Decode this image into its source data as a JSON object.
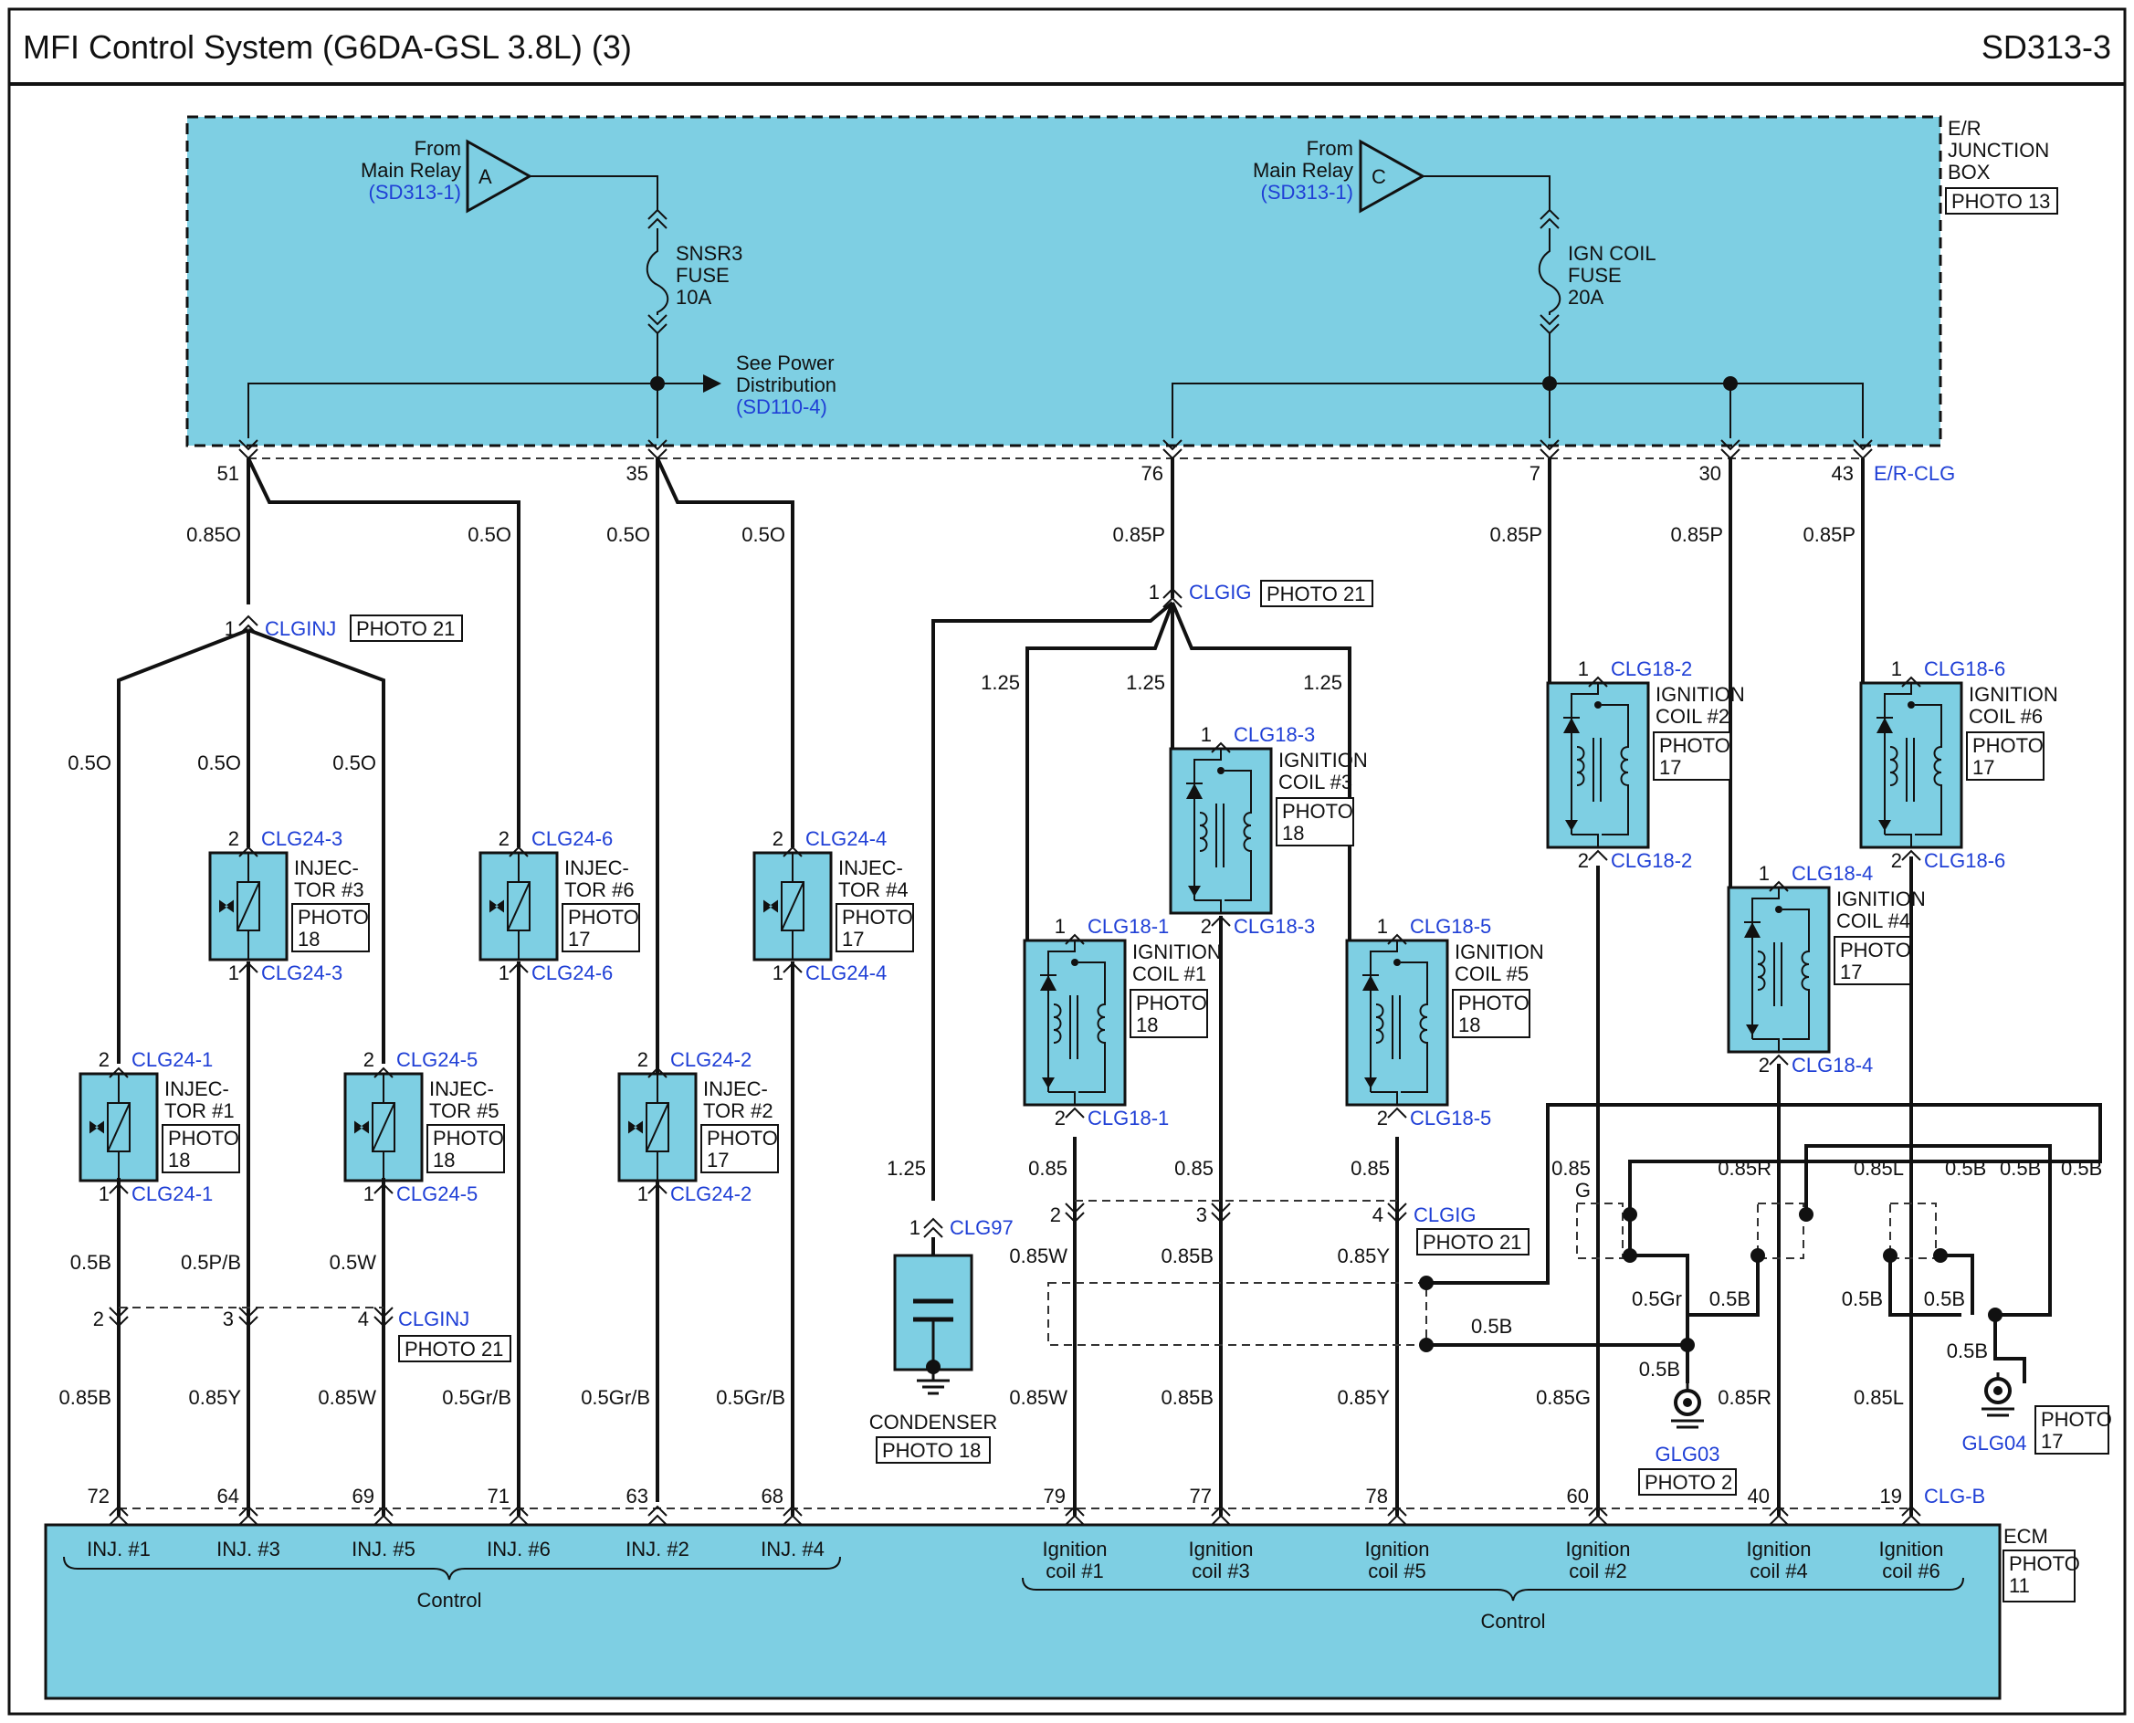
{
  "header": {
    "title": "MFI Control System (G6DA-GSL 3.8L) (3)",
    "code": "SD313-3"
  },
  "junction_box": {
    "name_lines": [
      "E/R",
      "JUNCTION",
      "BOX"
    ],
    "photo": "PHOTO 13"
  },
  "relays": [
    {
      "label_lines": [
        "From",
        "Main Relay"
      ],
      "ref": "(SD313-1)",
      "letter": "A"
    },
    {
      "label_lines": [
        "From",
        "Main Relay"
      ],
      "ref": "(SD313-1)",
      "letter": "C"
    }
  ],
  "fuses": [
    {
      "lines": [
        "SNSR3",
        "FUSE",
        "10A"
      ]
    },
    {
      "lines": [
        "IGN COIL",
        "FUSE",
        "20A"
      ]
    }
  ],
  "power_dist": {
    "lines": [
      "See Power",
      "Distribution"
    ],
    "ref": "(SD110-4)"
  },
  "er_pins": [
    "51",
    "35",
    "76",
    "7",
    "30",
    "43"
  ],
  "er_connector": "E/R-CLG",
  "wires_top": [
    "0.85O",
    "0.5O",
    "0.5O",
    "0.5O",
    "0.85P",
    "0.85P",
    "0.85P",
    "0.85P"
  ],
  "splices": {
    "clginj": {
      "pin": "1",
      "name": "CLGINJ",
      "photo": "PHOTO 21"
    },
    "clgig": {
      "pin": "1",
      "name": "CLGIG",
      "photo": "PHOTO 21"
    }
  },
  "injectors": [
    {
      "name_lines": [
        "INJEC-",
        "TOR #1"
      ],
      "photo": "PHOTO",
      "photo_no": "18",
      "top_pin": "2",
      "top_conn": "CLG24-1",
      "bot_pin": "1",
      "bot_conn": "CLG24-1"
    },
    {
      "name_lines": [
        "INJEC-",
        "TOR #3"
      ],
      "photo": "PHOTO",
      "photo_no": "18",
      "top_pin": "2",
      "top_conn": "CLG24-3",
      "bot_pin": "1",
      "bot_conn": "CLG24-3"
    },
    {
      "name_lines": [
        "INJEC-",
        "TOR #5"
      ],
      "photo": "PHOTO",
      "photo_no": "18",
      "top_pin": "2",
      "top_conn": "CLG24-5",
      "bot_pin": "1",
      "bot_conn": "CLG24-5"
    },
    {
      "name_lines": [
        "INJEC-",
        "TOR #6"
      ],
      "photo": "PHOTO",
      "photo_no": "17",
      "top_pin": "2",
      "top_conn": "CLG24-6",
      "bot_pin": "1",
      "bot_conn": "CLG24-6"
    },
    {
      "name_lines": [
        "INJEC-",
        "TOR #2"
      ],
      "photo": "PHOTO",
      "photo_no": "17",
      "top_pin": "2",
      "top_conn": "CLG24-2",
      "bot_pin": "1",
      "bot_conn": "CLG24-2"
    },
    {
      "name_lines": [
        "INJEC-",
        "TOR #4"
      ],
      "photo": "PHOTO",
      "photo_no": "17",
      "top_pin": "2",
      "top_conn": "CLG24-4",
      "bot_pin": "1",
      "bot_conn": "CLG24-4"
    }
  ],
  "coils": [
    {
      "name_lines": [
        "IGNITION",
        "COIL #1"
      ],
      "photo": "PHOTO",
      "photo_no": "18",
      "top_pin": "1",
      "top_conn": "CLG18-1",
      "bot_pin": "2",
      "bot_conn": "CLG18-1"
    },
    {
      "name_lines": [
        "IGNITION",
        "COIL #3"
      ],
      "photo": "PHOTO",
      "photo_no": "18",
      "top_pin": "1",
      "top_conn": "CLG18-3",
      "bot_pin": "2",
      "bot_conn": "CLG18-3"
    },
    {
      "name_lines": [
        "IGNITION",
        "COIL #5"
      ],
      "photo": "PHOTO",
      "photo_no": "18",
      "top_pin": "1",
      "top_conn": "CLG18-5",
      "bot_pin": "2",
      "bot_conn": "CLG18-5"
    },
    {
      "name_lines": [
        "IGNITION",
        "COIL #2"
      ],
      "photo": "PHOTO",
      "photo_no": "17",
      "top_pin": "1",
      "top_conn": "CLG18-2",
      "bot_pin": "2",
      "bot_conn": "CLG18-2"
    },
    {
      "name_lines": [
        "IGNITION",
        "COIL #4"
      ],
      "photo": "PHOTO",
      "photo_no": "17",
      "top_pin": "1",
      "top_conn": "CLG18-4",
      "bot_pin": "2",
      "bot_conn": "CLG18-4"
    },
    {
      "name_lines": [
        "IGNITION",
        "COIL #6"
      ],
      "photo": "PHOTO",
      "photo_no": "17",
      "top_pin": "1",
      "top_conn": "CLG18-6",
      "bot_pin": "2",
      "bot_conn": "CLG18-6"
    }
  ],
  "condenser": {
    "name": "CONDENSER",
    "photo": "PHOTO 18",
    "pin": "1",
    "conn": "CLG97"
  },
  "mid_connectors": {
    "clginj_bottom": {
      "name": "CLGINJ",
      "photo": "PHOTO 21",
      "pins": [
        "2",
        "3",
        "4"
      ]
    },
    "clgig_bottom": {
      "name": "CLGIG",
      "photo": "PHOTO 21",
      "pins": [
        "2",
        "3",
        "4"
      ]
    }
  },
  "wire_labels": {
    "inj_upper": [
      "0.5O",
      "0.5O",
      "0.5O"
    ],
    "inj_lower": [
      "0.5B",
      "0.5P/B",
      "0.5W"
    ],
    "inj_ecm": [
      "0.85B",
      "0.85Y",
      "0.85W",
      "0.5Gr/B",
      "0.5Gr/B",
      "0.5Gr/B"
    ],
    "coil_upper": [
      "1.25",
      "1.25",
      "1.25",
      "1.25"
    ],
    "coil_mid": [
      "0.85",
      "0.85",
      "0.85"
    ],
    "coil_mid2": [
      "0.85W",
      "0.85B",
      "0.85Y"
    ],
    "coil_ecm": [
      "0.85W",
      "0.85B",
      "0.85Y",
      "0.85G",
      "0.85R",
      "0.85L"
    ],
    "shield": [
      "0.85",
      "G",
      "0.85R",
      "0.85L",
      "0.5B",
      "0.5B",
      "0.5B"
    ],
    "ground": [
      "0.5Gr",
      "0.5B",
      "0.5B",
      "0.5B",
      "0.5B",
      "0.5B",
      "0.5B"
    ]
  },
  "grounds": [
    {
      "name": "GLG03",
      "photo": "PHOTO 2"
    },
    {
      "name": "GLG04",
      "photo": "PHOTO",
      "photo_no": "17"
    }
  ],
  "ecm": {
    "name": "ECM",
    "photo": "PHOTO",
    "photo_no": "11",
    "connector": "CLG-B",
    "pins": [
      "72",
      "64",
      "69",
      "71",
      "63",
      "68",
      "79",
      "77",
      "78",
      "60",
      "40",
      "19"
    ],
    "inj_labels": [
      "INJ. #1",
      "INJ. #3",
      "INJ. #5",
      "INJ. #6",
      "INJ. #2",
      "INJ. #4"
    ],
    "coil_labels": [
      [
        "Ignition",
        "coil #1"
      ],
      [
        "Ignition",
        "coil #3"
      ],
      [
        "Ignition",
        "coil #5"
      ],
      [
        "Ignition",
        "coil #2"
      ],
      [
        "Ignition",
        "coil #4"
      ],
      [
        "Ignition",
        "coil #6"
      ]
    ],
    "control": [
      "Control",
      "Control"
    ]
  },
  "colors": {
    "component": "#7ecfe3",
    "ref_text": "#1f3fd6",
    "wire": "#111111"
  }
}
